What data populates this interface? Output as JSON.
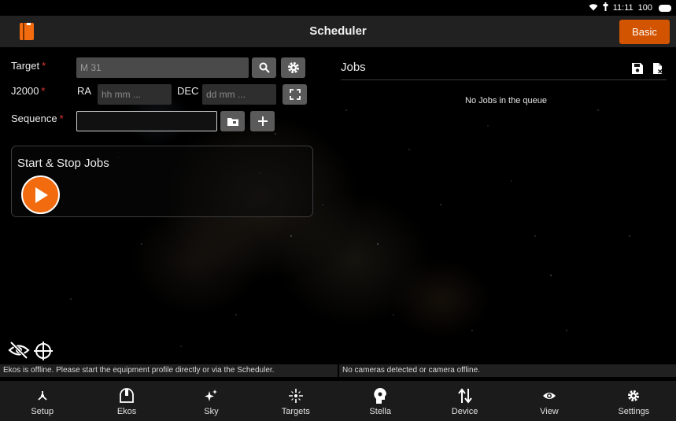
{
  "status_bar": {
    "time": "11:11",
    "battery": "100"
  },
  "app_bar": {
    "title": "Scheduler",
    "mode_button": "Basic"
  },
  "form": {
    "target_label": "Target",
    "target_value": "M 31",
    "j2000_label": "J2000",
    "ra_label": "RA",
    "ra_placeholder": "hh mm ...",
    "dec_label": "DEC",
    "dec_placeholder": "dd mm ...",
    "sequence_label": "Sequence",
    "sequence_value": "",
    "required_mark": "*"
  },
  "start_stop": {
    "title": "Start & Stop Jobs"
  },
  "jobs": {
    "title": "Jobs",
    "empty_text": "No Jobs in the queue"
  },
  "status_strip": {
    "ekos_message": "Ekos is offline. Please start the equipment profile directly or via the Scheduler.",
    "camera_message": "No cameras detected or camera offline."
  },
  "nav": {
    "items": [
      {
        "label": "Setup",
        "icon": "setup-icon"
      },
      {
        "label": "Ekos",
        "icon": "ekos-icon"
      },
      {
        "label": "Sky",
        "icon": "sky-icon"
      },
      {
        "label": "Targets",
        "icon": "targets-icon"
      },
      {
        "label": "Stella",
        "icon": "stella-icon"
      },
      {
        "label": "Device",
        "icon": "device-icon"
      },
      {
        "label": "View",
        "icon": "view-icon"
      },
      {
        "label": "Settings",
        "icon": "settings-icon"
      }
    ]
  },
  "colors": {
    "accent": "#d35400",
    "play": "#f26b0f",
    "required": "#e53935",
    "app_bar": "#212121",
    "nav": "#1b1b1b"
  }
}
